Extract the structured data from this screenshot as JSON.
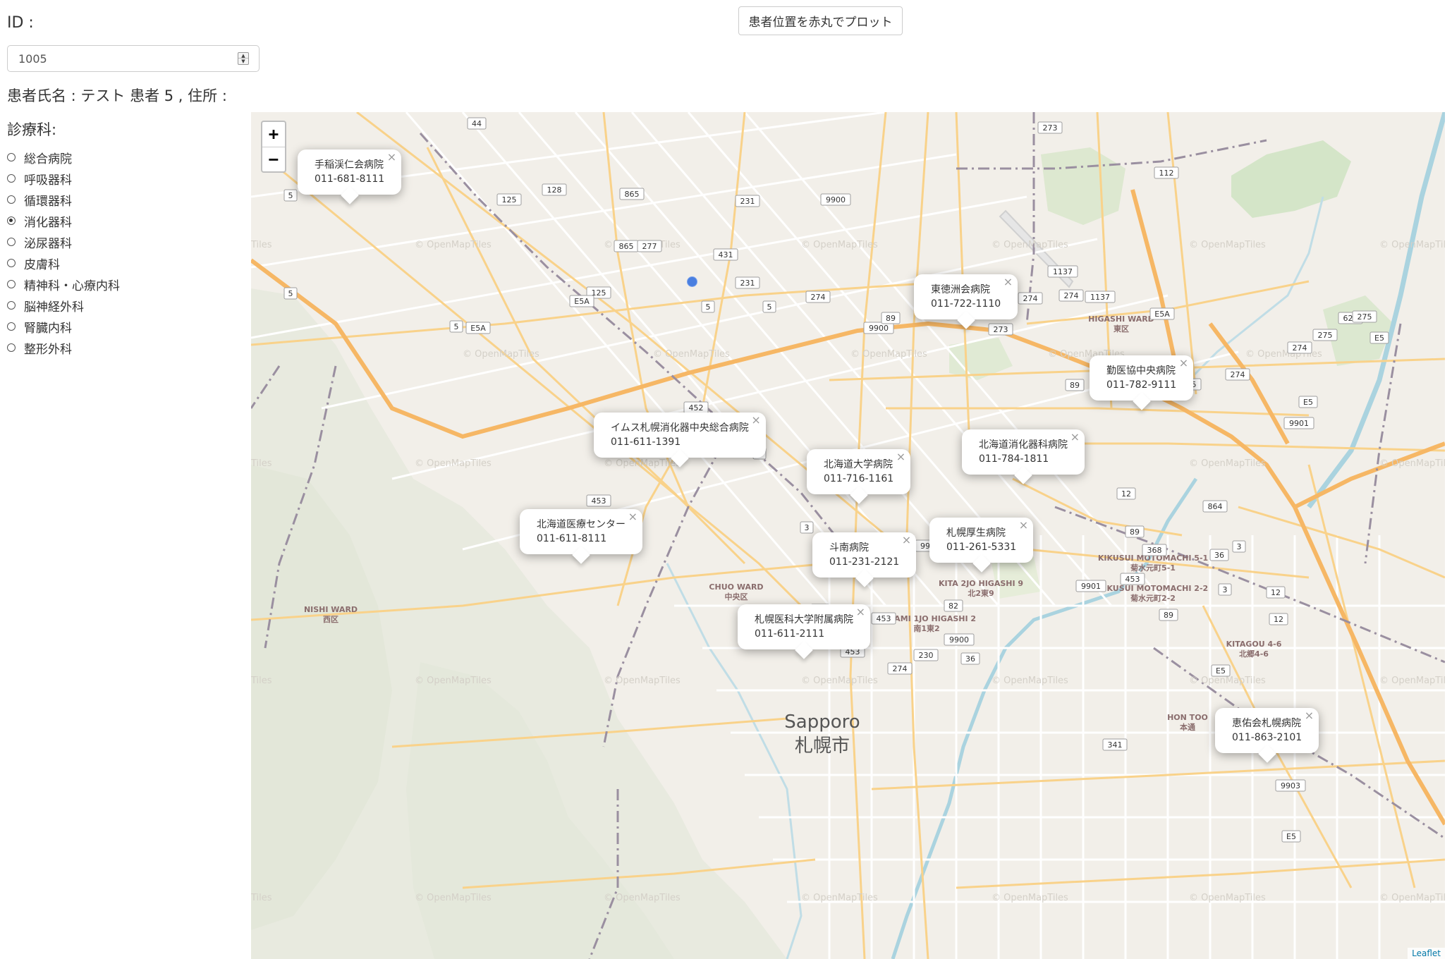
{
  "form": {
    "id_label": "ID :",
    "id_value": "1005",
    "patient_info": "患者氏名 : テスト 患者 5 , 住所 :",
    "dept_label": "診療科:",
    "departments": [
      {
        "label": "総合病院",
        "checked": false
      },
      {
        "label": "呼吸器科",
        "checked": false
      },
      {
        "label": "循環器科",
        "checked": false
      },
      {
        "label": "消化器科",
        "checked": true
      },
      {
        "label": "泌尿器科",
        "checked": false
      },
      {
        "label": "皮膚科",
        "checked": false
      },
      {
        "label": "精神科・心療内科",
        "checked": false
      },
      {
        "label": "脳神経外科",
        "checked": false
      },
      {
        "label": "腎臓内科",
        "checked": false
      },
      {
        "label": "整形外科",
        "checked": false
      }
    ]
  },
  "toolbar": {
    "plot_button": "患者位置を赤丸でプロット"
  },
  "map": {
    "zoom_in": "+",
    "zoom_out": "−",
    "attribution": "Leaflet",
    "tile_watermark": "© OpenMapTiles",
    "city_label_en": "Sapporo",
    "city_label_ja": "札幌市",
    "district_labels": [
      {
        "en": "NISHI WARD",
        "ja": "西区"
      },
      {
        "en": "CHUO WARD",
        "ja": "中央区"
      },
      {
        "en": "HIGASHI WARD",
        "ja": "東区"
      },
      {
        "en": "KITA 2JO HIGASHI 9",
        "ja": "北2東9"
      },
      {
        "en": "MINAMI 1JO HIGASHI 2",
        "ja": "南1東2"
      },
      {
        "en": "KIKUSUI MOTOMACHI 5-1",
        "ja": "菊水元町5-1"
      },
      {
        "en": "KIKUSUI MOTOMACHI 2-2",
        "ja": "菊水元町2-2"
      },
      {
        "en": "KITAGOU 4-6",
        "ja": "北郷4-6"
      },
      {
        "en": "HON TOO",
        "ja": "本通"
      }
    ],
    "route_shields": [
      "44",
      "273",
      "128",
      "125",
      "865",
      "231",
      "9900",
      "273",
      "112",
      "5",
      "865",
      "277",
      "431",
      "5",
      "1137",
      "231",
      "274",
      "125",
      "E5A",
      "5",
      "5",
      "274",
      "9900",
      "E5A",
      "274",
      "1137",
      "89",
      "626",
      "275",
      "E5A",
      "5",
      "274",
      "275",
      "E5",
      "452",
      "89",
      "275",
      "274",
      "9901",
      "E5",
      "5",
      "12",
      "453",
      "864",
      "3",
      "9901",
      "89",
      "368",
      "453",
      "89",
      "9901",
      "3",
      "12",
      "36",
      "E5",
      "12",
      "3",
      "89",
      "453",
      "453",
      "9900",
      "82",
      "230",
      "36",
      "274",
      "341",
      "9903",
      "E5"
    ],
    "popups": [
      {
        "name": "手稲渓仁会病院",
        "tel": "011-681-8111"
      },
      {
        "name": "東徳洲会病院",
        "tel": "011-722-1110"
      },
      {
        "name": "勤医協中央病院",
        "tel": "011-782-9111"
      },
      {
        "name": "イムス札幌消化器中央総合病院",
        "tel": "011-611-1391"
      },
      {
        "name": "北海道消化器科病院",
        "tel": "011-784-1811"
      },
      {
        "name": "北海道大学病院",
        "tel": "011-716-1161"
      },
      {
        "name": "北海道医療センター",
        "tel": "011-611-8111"
      },
      {
        "name": "斗南病院",
        "tel": "011-231-2121"
      },
      {
        "name": "札幌厚生病院",
        "tel": "011-261-5331"
      },
      {
        "name": "札幌医科大学附属病院",
        "tel": "011-611-2111"
      },
      {
        "name": "恵佑会札幌病院",
        "tel": "011-863-2101"
      }
    ],
    "patient_marker_color": "#4a7fe0"
  }
}
